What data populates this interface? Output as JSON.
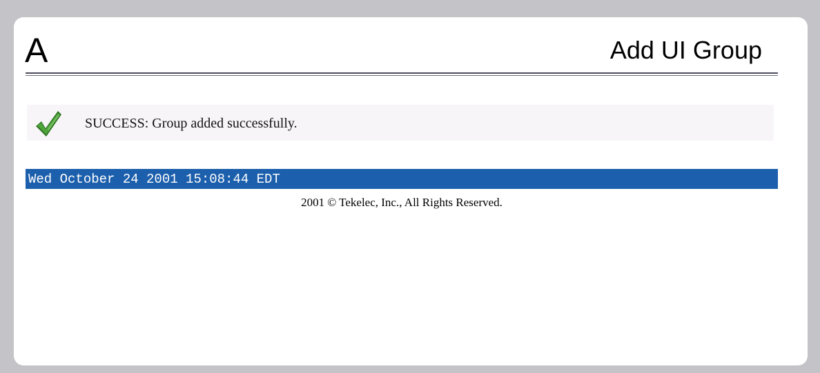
{
  "header": {
    "letter": "A",
    "title": "Add UI Group"
  },
  "message": {
    "icon": "checkmark-icon",
    "icon_color": "#3e8a2c",
    "text": "SUCCESS: Group added successfully."
  },
  "status_bar": {
    "timestamp": "Wed October 24 2001 15:08:44 EDT",
    "background": "#1c5fac"
  },
  "footer": {
    "copyright": "2001 © Tekelec, Inc., All Rights Reserved."
  }
}
